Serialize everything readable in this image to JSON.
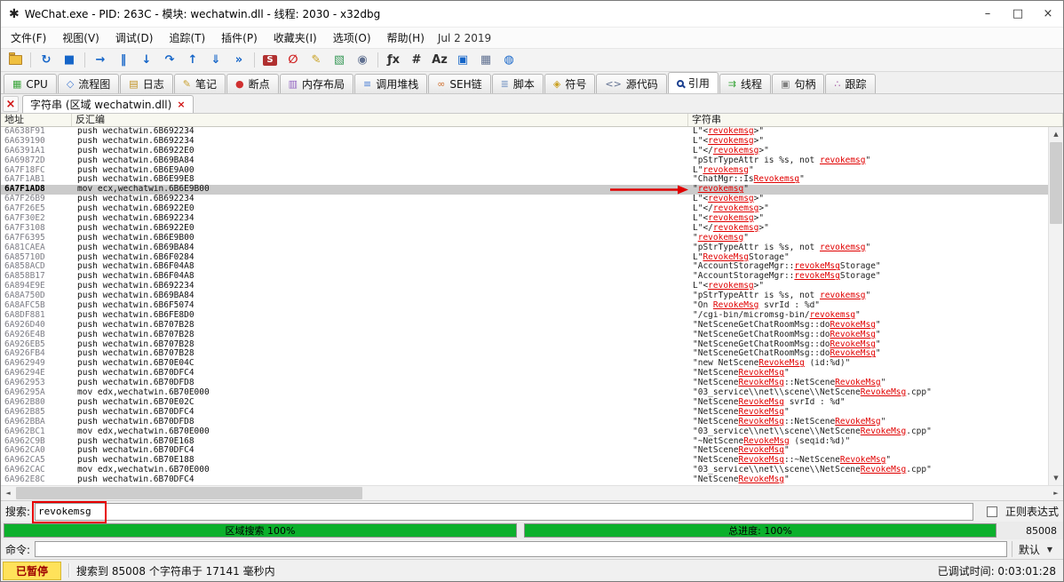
{
  "window": {
    "title": "WeChat.exe - PID: 263C - 模块: wechatwin.dll - 线程: 2030 - x32dbg",
    "app_icon_glyph": "✱",
    "controls": {
      "minimize": "–",
      "maximize": "□",
      "close": "×"
    }
  },
  "menu": {
    "items": [
      "文件(F)",
      "视图(V)",
      "调试(D)",
      "追踪(T)",
      "插件(P)",
      "收藏夹(I)",
      "选项(O)",
      "帮助(H)"
    ],
    "build_date": "Jul 2 2019"
  },
  "toolbar": {
    "buttons": [
      {
        "name": "open-file-icon",
        "glyph": "folder",
        "color": "#f0c040"
      },
      {
        "sep": true
      },
      {
        "name": "restart-icon",
        "glyph": "↻",
        "color": "#1565c8"
      },
      {
        "name": "stop-icon",
        "glyph": "■",
        "color": "#1565c8"
      },
      {
        "sep": true
      },
      {
        "name": "run-icon",
        "glyph": "→",
        "color": "#1565c8"
      },
      {
        "name": "pause-icon",
        "glyph": "‖",
        "color": "#1565c8"
      },
      {
        "name": "step-into-icon",
        "glyph": "↓",
        "color": "#1565c8"
      },
      {
        "name": "step-over-icon",
        "glyph": "↷",
        "color": "#1565c8"
      },
      {
        "name": "step-out-icon",
        "glyph": "↑",
        "color": "#1565c8"
      },
      {
        "name": "run-to-cursor-icon",
        "glyph": "⇓",
        "color": "#1565c8"
      },
      {
        "name": "trace-into-icon",
        "glyph": "»",
        "color": "#1565c8"
      },
      {
        "sep": true
      },
      {
        "name": "settings-icon",
        "glyph": "S",
        "color": "#ffffff",
        "bg": "#b03030"
      },
      {
        "name": "remove-breakpoints-icon",
        "glyph": "∅",
        "color": "#d02020"
      },
      {
        "name": "notes-icon",
        "glyph": "✎",
        "color": "#c8a020"
      },
      {
        "name": "patch-icon",
        "glyph": "▧",
        "color": "#3a9a5a"
      },
      {
        "name": "watch-icon",
        "glyph": "◉",
        "color": "#607090"
      },
      {
        "sep": true
      },
      {
        "name": "functions-icon",
        "glyph": "ƒx",
        "color": "#303030"
      },
      {
        "name": "hash-icon",
        "glyph": "#",
        "color": "#303030"
      },
      {
        "name": "text-encoding-icon",
        "glyph": "Az",
        "color": "#303030"
      },
      {
        "name": "window-icon",
        "glyph": "▣",
        "color": "#1565c8"
      },
      {
        "name": "memory-grid-icon",
        "glyph": "▦",
        "color": "#607090"
      },
      {
        "name": "help-globe-icon",
        "glyph": "◍",
        "color": "#1565c8"
      }
    ]
  },
  "view_tabs": [
    {
      "name": "tab-cpu",
      "label": "CPU",
      "icon": "cpu-icon",
      "color": "#3aa53a",
      "glyph": "▦"
    },
    {
      "name": "tab-graph",
      "label": "流程图",
      "icon": "graph-icon",
      "color": "#4a7fd4",
      "glyph": "◇"
    },
    {
      "name": "tab-log",
      "label": "日志",
      "icon": "log-icon",
      "color": "#c09020",
      "glyph": "▤"
    },
    {
      "name": "tab-notes",
      "label": "笔记",
      "icon": "notes-icon",
      "color": "#c8a030",
      "glyph": "✎"
    },
    {
      "name": "tab-breakpoints",
      "label": "断点",
      "icon": "breakpoint-icon",
      "color": "#d03030",
      "glyph": "●"
    },
    {
      "name": "tab-memory-map",
      "label": "内存布局",
      "icon": "memory-map-icon",
      "color": "#9060c0",
      "glyph": "▥"
    },
    {
      "name": "tab-call-stack",
      "label": "调用堆栈",
      "icon": "call-stack-icon",
      "color": "#4a7fd4",
      "glyph": "≡"
    },
    {
      "name": "tab-seh",
      "label": "SEH链",
      "icon": "seh-chain-icon",
      "color": "#d07030",
      "glyph": "∞"
    },
    {
      "name": "tab-script",
      "label": "脚本",
      "icon": "script-icon",
      "color": "#7090c0",
      "glyph": "≣"
    },
    {
      "name": "tab-symbols",
      "label": "符号",
      "icon": "symbols-icon",
      "color": "#caa020",
      "glyph": "◈"
    },
    {
      "name": "tab-source",
      "label": "源代码",
      "icon": "source-code-icon",
      "color": "#607090",
      "glyph": "<>"
    },
    {
      "name": "tab-references",
      "label": "引用",
      "icon": "search-icon",
      "color": "#1a3f8f",
      "glyph": "mag",
      "active": true
    },
    {
      "name": "tab-threads",
      "label": "线程",
      "icon": "threads-icon",
      "color": "#3aa53a",
      "glyph": "⇉"
    },
    {
      "name": "tab-handles",
      "label": "句柄",
      "icon": "handles-icon",
      "color": "#808080",
      "glyph": "▣"
    },
    {
      "name": "tab-trace",
      "label": "跟踪",
      "icon": "trace-icon",
      "color": "#a050a0",
      "glyph": "∴"
    }
  ],
  "subtab": {
    "close_all_glyph": "×",
    "label": "字符串 (区域 wechatwin.dll)",
    "close_glyph": "×"
  },
  "table": {
    "columns": [
      "地址",
      "反汇编",
      "字符串"
    ],
    "search_term": "revokemsg",
    "selected_address": "6A7F1AD8",
    "rows": [
      {
        "address": "6A638F91",
        "disasm": "push wechatwin.6B692234",
        "string": "L\"<revokemsg>\""
      },
      {
        "address": "6A639190",
        "disasm": "push wechatwin.6B692234",
        "string": "L\"<revokemsg>\""
      },
      {
        "address": "6A6391A1",
        "disasm": "push wechatwin.6B6922E0",
        "string": "L\"</revokemsg>\""
      },
      {
        "address": "6A69872D",
        "disasm": "push wechatwin.6B69BA84",
        "string": "\"pStrTypeAttr is %s, not revokemsg\""
      },
      {
        "address": "6A7F18FC",
        "disasm": "push wechatwin.6B6E9A00",
        "string": "L\"revokemsg\""
      },
      {
        "address": "6A7F1AB1",
        "disasm": "push wechatwin.6B6E99E8",
        "string": "\"ChatMgr::IsRevokemsg\""
      },
      {
        "address": "6A7F1AD8",
        "disasm": "mov ecx,wechatwin.6B6E9B00",
        "string": "\"revokemsg\""
      },
      {
        "address": "6A7F26B9",
        "disasm": "push wechatwin.6B692234",
        "string": "L\"<revokemsg>\""
      },
      {
        "address": "6A7F26E5",
        "disasm": "push wechatwin.6B6922E0",
        "string": "L\"</revokemsg>\""
      },
      {
        "address": "6A7F30E2",
        "disasm": "push wechatwin.6B692234",
        "string": "L\"<revokemsg>\""
      },
      {
        "address": "6A7F3108",
        "disasm": "push wechatwin.6B6922E0",
        "string": "L\"</revokemsg>\""
      },
      {
        "address": "6A7F6395",
        "disasm": "push wechatwin.6B6E9B00",
        "string": "\"revokemsg\""
      },
      {
        "address": "6A81CAEA",
        "disasm": "push wechatwin.6B69BA84",
        "string": "\"pStrTypeAttr is %s, not revokemsg\""
      },
      {
        "address": "6A85710D",
        "disasm": "push wechatwin.6B6F0284",
        "string": "L\"RevokeMsgStorage\""
      },
      {
        "address": "6A858ACD",
        "disasm": "push wechatwin.6B6F04A8",
        "string": "\"AccountStorageMgr::revokeMsgStorage\""
      },
      {
        "address": "6A858B17",
        "disasm": "push wechatwin.6B6F04A8",
        "string": "\"AccountStorageMgr::revokeMsgStorage\""
      },
      {
        "address": "6A894E9E",
        "disasm": "push wechatwin.6B692234",
        "string": "L\"<revokemsg>\""
      },
      {
        "address": "6A8A750D",
        "disasm": "push wechatwin.6B69BA84",
        "string": "\"pStrTypeAttr is %s, not revokemsg\""
      },
      {
        "address": "6A8AFC5B",
        "disasm": "push wechatwin.6B6F5074",
        "string": "\"On RevokeMsg svrId : %d\""
      },
      {
        "address": "6A8DF881",
        "disasm": "push wechatwin.6B6FE8D0",
        "string": "\"/cgi-bin/micromsg-bin/revokemsg\""
      },
      {
        "address": "6A926D40",
        "disasm": "push wechatwin.6B707B28",
        "string": "\"NetSceneGetChatRoomMsg::doRevokeMsg\""
      },
      {
        "address": "6A926E4B",
        "disasm": "push wechatwin.6B707B28",
        "string": "\"NetSceneGetChatRoomMsg::doRevokeMsg\""
      },
      {
        "address": "6A926EB5",
        "disasm": "push wechatwin.6B707B28",
        "string": "\"NetSceneGetChatRoomMsg::doRevokeMsg\""
      },
      {
        "address": "6A926FB4",
        "disasm": "push wechatwin.6B707B28",
        "string": "\"NetSceneGetChatRoomMsg::doRevokeMsg\""
      },
      {
        "address": "6A962949",
        "disasm": "push wechatwin.6B70E04C",
        "string": "\"new NetSceneRevokeMsg (id:%d)\""
      },
      {
        "address": "6A96294E",
        "disasm": "push wechatwin.6B70DFC4",
        "string": "\"NetSceneRevokeMsg\""
      },
      {
        "address": "6A962953",
        "disasm": "push wechatwin.6B70DFD8",
        "string": "\"NetSceneRevokeMsg::NetSceneRevokeMsg\""
      },
      {
        "address": "6A96295A",
        "disasm": "mov edx,wechatwin.6B70E000",
        "string": "\"03_service\\\\net\\\\scene\\\\NetSceneRevokeMsg.cpp\""
      },
      {
        "address": "6A962B80",
        "disasm": "push wechatwin.6B70E02C",
        "string": "\"NetSceneRevokeMsg svrId : %d\""
      },
      {
        "address": "6A962B85",
        "disasm": "push wechatwin.6B70DFC4",
        "string": "\"NetSceneRevokeMsg\""
      },
      {
        "address": "6A962BBA",
        "disasm": "push wechatwin.6B70DFD8",
        "string": "\"NetSceneRevokeMsg::NetSceneRevokeMsg\""
      },
      {
        "address": "6A962BC1",
        "disasm": "mov edx,wechatwin.6B70E000",
        "string": "\"03_service\\\\net\\\\scene\\\\NetSceneRevokeMsg.cpp\""
      },
      {
        "address": "6A962C9B",
        "disasm": "push wechatwin.6B70E168",
        "string": "\"~NetSceneRevokeMsg (seqid:%d)\""
      },
      {
        "address": "6A962CA0",
        "disasm": "push wechatwin.6B70DFC4",
        "string": "\"NetSceneRevokeMsg\""
      },
      {
        "address": "6A962CA5",
        "disasm": "push wechatwin.6B70E188",
        "string": "\"NetSceneRevokeMsg::~NetSceneRevokeMsg\""
      },
      {
        "address": "6A962CAC",
        "disasm": "mov edx,wechatwin.6B70E000",
        "string": "\"03_service\\\\net\\\\scene\\\\NetSceneRevokeMsg.cpp\""
      },
      {
        "address": "6A962E8C",
        "disasm": "push wechatwin.6B70DFC4",
        "string": "\"NetSceneRevokeMsg\""
      }
    ]
  },
  "scrollbar": {
    "up": "▲",
    "down": "▼",
    "left": "◄",
    "right": "►"
  },
  "search": {
    "label": "搜索:",
    "value": "revokemsg",
    "regex_label": "正则表达式"
  },
  "progress": {
    "region_label": "区域搜索 100%",
    "total_label": "总进度: 100%",
    "count": "85008",
    "bar_color": "#0cb02c"
  },
  "command": {
    "label": "命令:",
    "value": "",
    "profile": "默认",
    "caret": "▼"
  },
  "status": {
    "state": "已暂停",
    "message": "搜索到 85008 个字符串于 17141 毫秒内",
    "debug_time": "已调试时间: 0:03:01:28"
  },
  "annotations": {
    "match_color": "#e00000"
  }
}
